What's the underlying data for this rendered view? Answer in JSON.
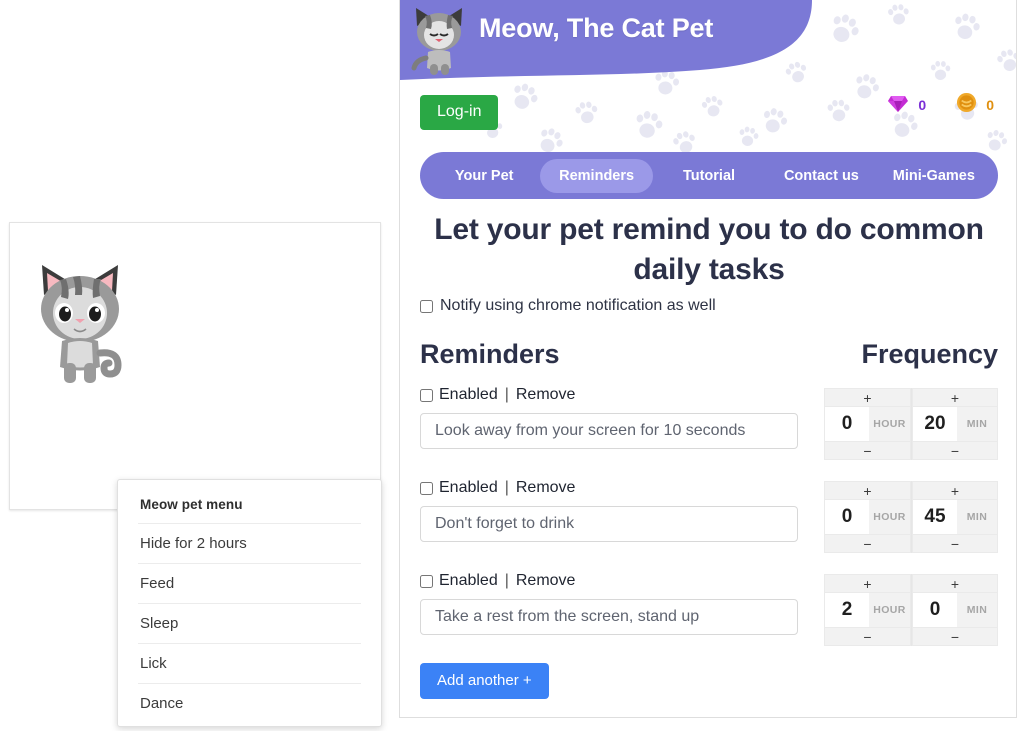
{
  "pet_panel": {
    "pet_name": "cat-sprite",
    "menu": {
      "title": "Meow pet menu",
      "items": [
        {
          "label": "Hide for 2 hours"
        },
        {
          "label": "Feed"
        },
        {
          "label": "Sleep"
        },
        {
          "label": "Lick"
        },
        {
          "label": "Dance"
        }
      ]
    }
  },
  "app": {
    "title": "Meow, The Cat Pet",
    "login_label": "Log-in",
    "currency": {
      "gem_icon": "gem-icon",
      "gem_value": "0",
      "coin_icon": "coin-icon",
      "coin_value": "0"
    },
    "nav": [
      {
        "label": "Your Pet",
        "active": false
      },
      {
        "label": "Reminders",
        "active": true
      },
      {
        "label": "Tutorial",
        "active": false
      },
      {
        "label": "Contact us",
        "active": false
      },
      {
        "label": "Mini-Games",
        "active": false
      }
    ],
    "headline": "Let your pet remind you to do common daily tasks",
    "chrome_notify_label": "Notify using chrome notification as well",
    "chrome_notify_checked": false,
    "columns": {
      "reminders": "Reminders",
      "frequency": "Frequency"
    },
    "row_controls": {
      "enabled_label": "Enabled",
      "separator": "|",
      "remove_label": "Remove",
      "plus_label": "+",
      "minus_label": "−",
      "hour_unit": "HOUR",
      "min_unit": "MIN"
    },
    "reminders": [
      {
        "enabled": false,
        "text": "Look away from your screen for 10 seconds",
        "hours": "0",
        "minutes": "20"
      },
      {
        "enabled": false,
        "text": "Don't forget to drink",
        "hours": "0",
        "minutes": "45"
      },
      {
        "enabled": false,
        "text": "Take a rest from the screen, stand up",
        "hours": "2",
        "minutes": "0"
      }
    ],
    "add_button_label": "Add another +"
  },
  "colors": {
    "banner_purple": "#7b79d6",
    "nav_active": "#9b99e8",
    "login_green": "#2aa845",
    "add_blue": "#3b82f6",
    "heading_navy": "#2c3149",
    "gem_magenta": "#c42bd4",
    "coin_gold": "#f0a92a"
  }
}
